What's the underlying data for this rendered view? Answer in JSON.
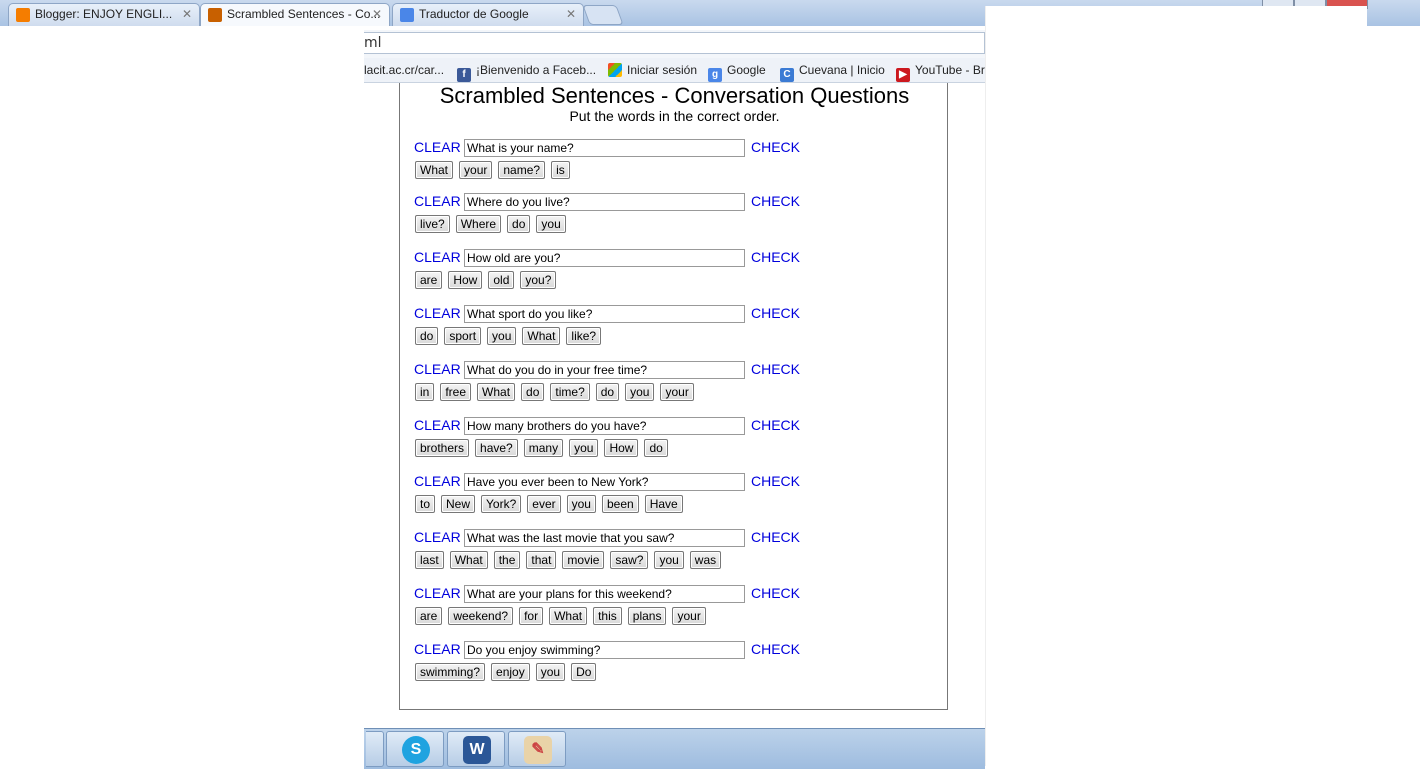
{
  "browser": {
    "tabs": [
      {
        "label": "Blogger: ENJOY ENGLI...",
        "active": false
      },
      {
        "label": "Scrambled Sentences - Co...",
        "active": true
      },
      {
        "label": "Traductor de Google",
        "active": false
      }
    ],
    "url": "ml",
    "bookmarks": [
      {
        "label": "lacit.ac.cr/car...",
        "icon": "page-icon"
      },
      {
        "label": "¡Bienvenido a Faceb...",
        "icon": "facebook-icon"
      },
      {
        "label": "Iniciar sesión",
        "icon": "windows-live-icon"
      },
      {
        "label": "Google",
        "icon": "google-icon"
      },
      {
        "label": "Cuevana | Inicio",
        "icon": "cuevana-icon"
      },
      {
        "label": "YouTube - Br",
        "icon": "youtube-icon"
      }
    ]
  },
  "page": {
    "title": "Scrambled Sentences - Conversation Questions",
    "subtitle": "Put the words in the correct order.",
    "clear_label": "CLEAR",
    "check_label": "CHECK",
    "questions": [
      {
        "answer": "What is your name?",
        "words": [
          "What",
          "your",
          "name?",
          "is"
        ]
      },
      {
        "answer": "Where do you live?",
        "words": [
          "live?",
          "Where",
          "do",
          "you"
        ]
      },
      {
        "answer": "How old are you?",
        "words": [
          "are",
          "How",
          "old",
          "you?"
        ]
      },
      {
        "answer": "What sport do you like?",
        "words": [
          "do",
          "sport",
          "you",
          "What",
          "like?"
        ]
      },
      {
        "answer": "What do you do in your free time?",
        "words": [
          "in",
          "free",
          "What",
          "do",
          "time?",
          "do",
          "you",
          "your"
        ]
      },
      {
        "answer": "How many brothers do you have?",
        "words": [
          "brothers",
          "have?",
          "many",
          "you",
          "How",
          "do"
        ]
      },
      {
        "answer": "Have you ever been to New York?",
        "words": [
          "to",
          "New",
          "York?",
          "ever",
          "you",
          "been",
          "Have"
        ]
      },
      {
        "answer": "What was the last movie that you saw?",
        "words": [
          "last",
          "What",
          "the",
          "that",
          "movie",
          "saw?",
          "you",
          "was"
        ]
      },
      {
        "answer": "What are your plans for this weekend?",
        "words": [
          "are",
          "weekend?",
          "for",
          "What",
          "this",
          "plans",
          "your"
        ]
      },
      {
        "answer": "Do you enjoy swimming?",
        "words": [
          "swimming?",
          "enjoy",
          "you",
          "Do"
        ]
      }
    ]
  },
  "taskbar": {
    "items": [
      {
        "icon": "skype-icon",
        "color": "#1fa3e0"
      },
      {
        "icon": "word-icon",
        "color": "#2b5797"
      },
      {
        "icon": "paint-icon",
        "color": "#c98a2a"
      }
    ]
  },
  "colors": {
    "link": "#0000dd"
  }
}
